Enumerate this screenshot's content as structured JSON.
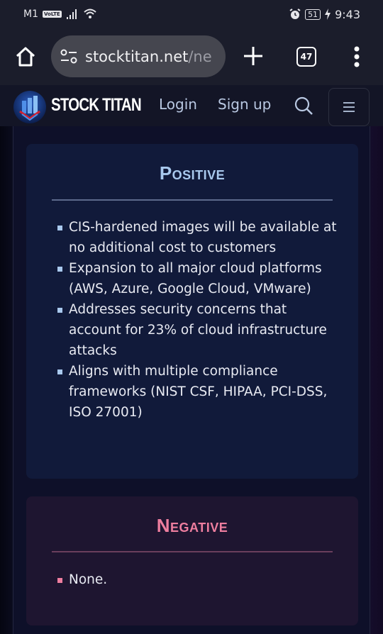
{
  "status_bar": {
    "carrier": "M1",
    "volte": "VoLTE",
    "battery": "51",
    "time": "9:43"
  },
  "browser": {
    "url_domain": "stocktitan.net",
    "url_path": "/ne",
    "tab_count": "47"
  },
  "site_header": {
    "brand": "STOCK TITAN",
    "login_label": "Login",
    "signup_label": "Sign up"
  },
  "positive": {
    "title": "Positive",
    "accent_color": "#a9c9ee",
    "items": [
      "CIS-hardened images will be available at no additional cost to customers",
      "Expansion to all major cloud platforms (AWS, Azure, Google Cloud, VMware)",
      "Addresses security concerns that account for 23% of cloud infrastructure attacks",
      "Aligns with multiple compliance frameworks (NIST CSF, HIPAA, PCI-DSS, ISO 27001)"
    ]
  },
  "negative": {
    "title": "Negative",
    "accent_color": "#ee7e9f",
    "items": [
      "None."
    ]
  }
}
